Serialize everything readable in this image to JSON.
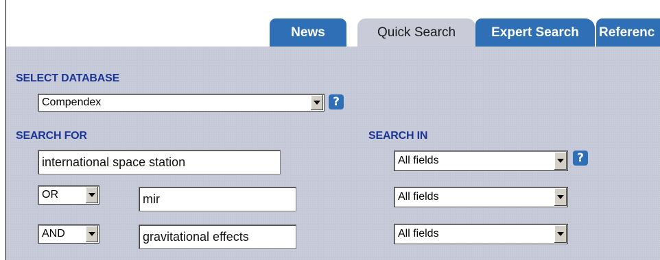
{
  "tabs": [
    {
      "label": "News",
      "active": false
    },
    {
      "label": "Quick Search",
      "active": true
    },
    {
      "label": "Expert Search",
      "active": false
    },
    {
      "label": "Referenc",
      "active": false
    }
  ],
  "select_database": {
    "label": "SELECT DATABASE",
    "value": "Compendex",
    "help": "?"
  },
  "search_for": {
    "label": "SEARCH FOR",
    "rows": [
      {
        "operator": null,
        "term": "international space station"
      },
      {
        "operator": "OR",
        "term": "mir"
      },
      {
        "operator": "AND",
        "term": "gravitational effects"
      }
    ]
  },
  "search_in": {
    "label": "SEARCH IN",
    "values": [
      "All fields",
      "All fields",
      "All fields"
    ],
    "help": "?"
  },
  "colors": {
    "tab_blue": "#2f6fb5",
    "label_blue": "#1a3596",
    "panel_bg": "#c6cad8"
  }
}
